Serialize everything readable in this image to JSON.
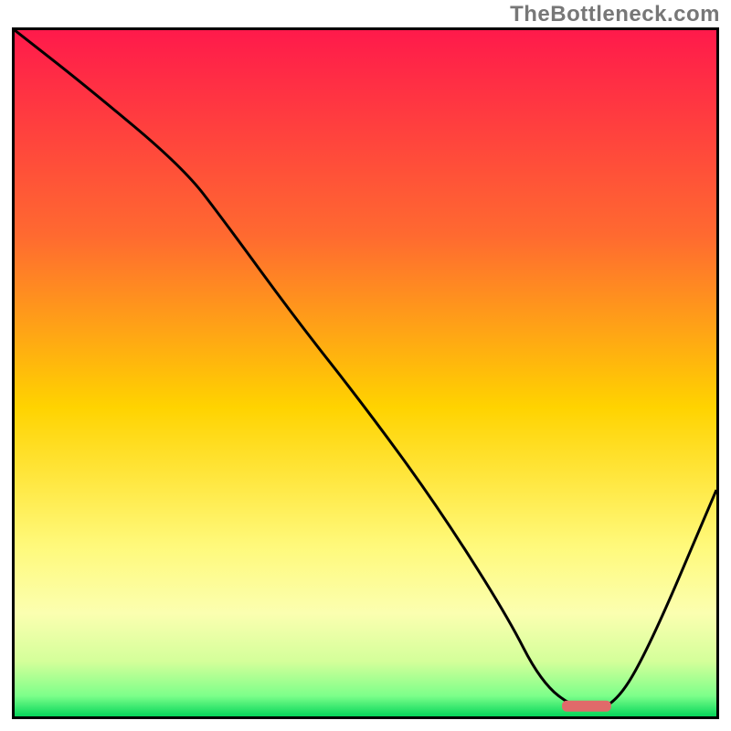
{
  "watermark": "TheBottleneck.com",
  "chart_data": {
    "type": "line",
    "title": "",
    "xlabel": "",
    "ylabel": "",
    "xlim": [
      0,
      100
    ],
    "ylim": [
      0,
      100
    ],
    "gradient_stops": [
      {
        "offset": 0,
        "color": "#ff1a4b"
      },
      {
        "offset": 30,
        "color": "#ff6a30"
      },
      {
        "offset": 55,
        "color": "#ffd300"
      },
      {
        "offset": 75,
        "color": "#fff97a"
      },
      {
        "offset": 85,
        "color": "#fbffb0"
      },
      {
        "offset": 92,
        "color": "#d4ff9a"
      },
      {
        "offset": 97,
        "color": "#7dff8a"
      },
      {
        "offset": 100,
        "color": "#06d65b"
      }
    ],
    "series": [
      {
        "name": "bottleneck-curve",
        "x": [
          0,
          10,
          24,
          30,
          40,
          50,
          60,
          70,
          75,
          80,
          85,
          90,
          100
        ],
        "y": [
          100,
          92,
          80,
          72,
          58,
          45,
          31,
          15,
          5,
          1,
          1,
          9,
          33
        ]
      }
    ],
    "marker": {
      "name": "optimal-zone",
      "x_start": 78,
      "x_end": 85,
      "y": 1.5,
      "color": "#e06a6a"
    }
  }
}
